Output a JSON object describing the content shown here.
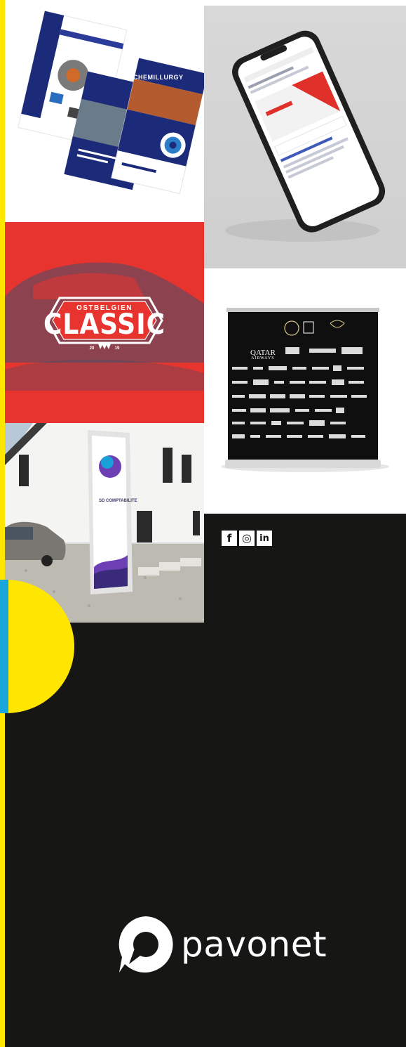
{
  "brochure": {
    "title": "CHEMILLURGY"
  },
  "classic": {
    "top": "OSTBELGIEN",
    "main": "CLASSIC",
    "year_left": "20",
    "year_right": "19"
  },
  "rollup": {
    "qatar": "QATAR",
    "qatar_sub": "AIRWAYS"
  },
  "sign": {
    "company": "SD COMPTABILITE"
  },
  "social": {
    "facebook": "f",
    "instagram": "◎",
    "linkedin": "in"
  },
  "logo": {
    "text": "pavonet"
  },
  "colors": {
    "yellow": "#ffe600",
    "blue": "#1aa6da",
    "dark": "#161615",
    "red": "#e8342e"
  }
}
